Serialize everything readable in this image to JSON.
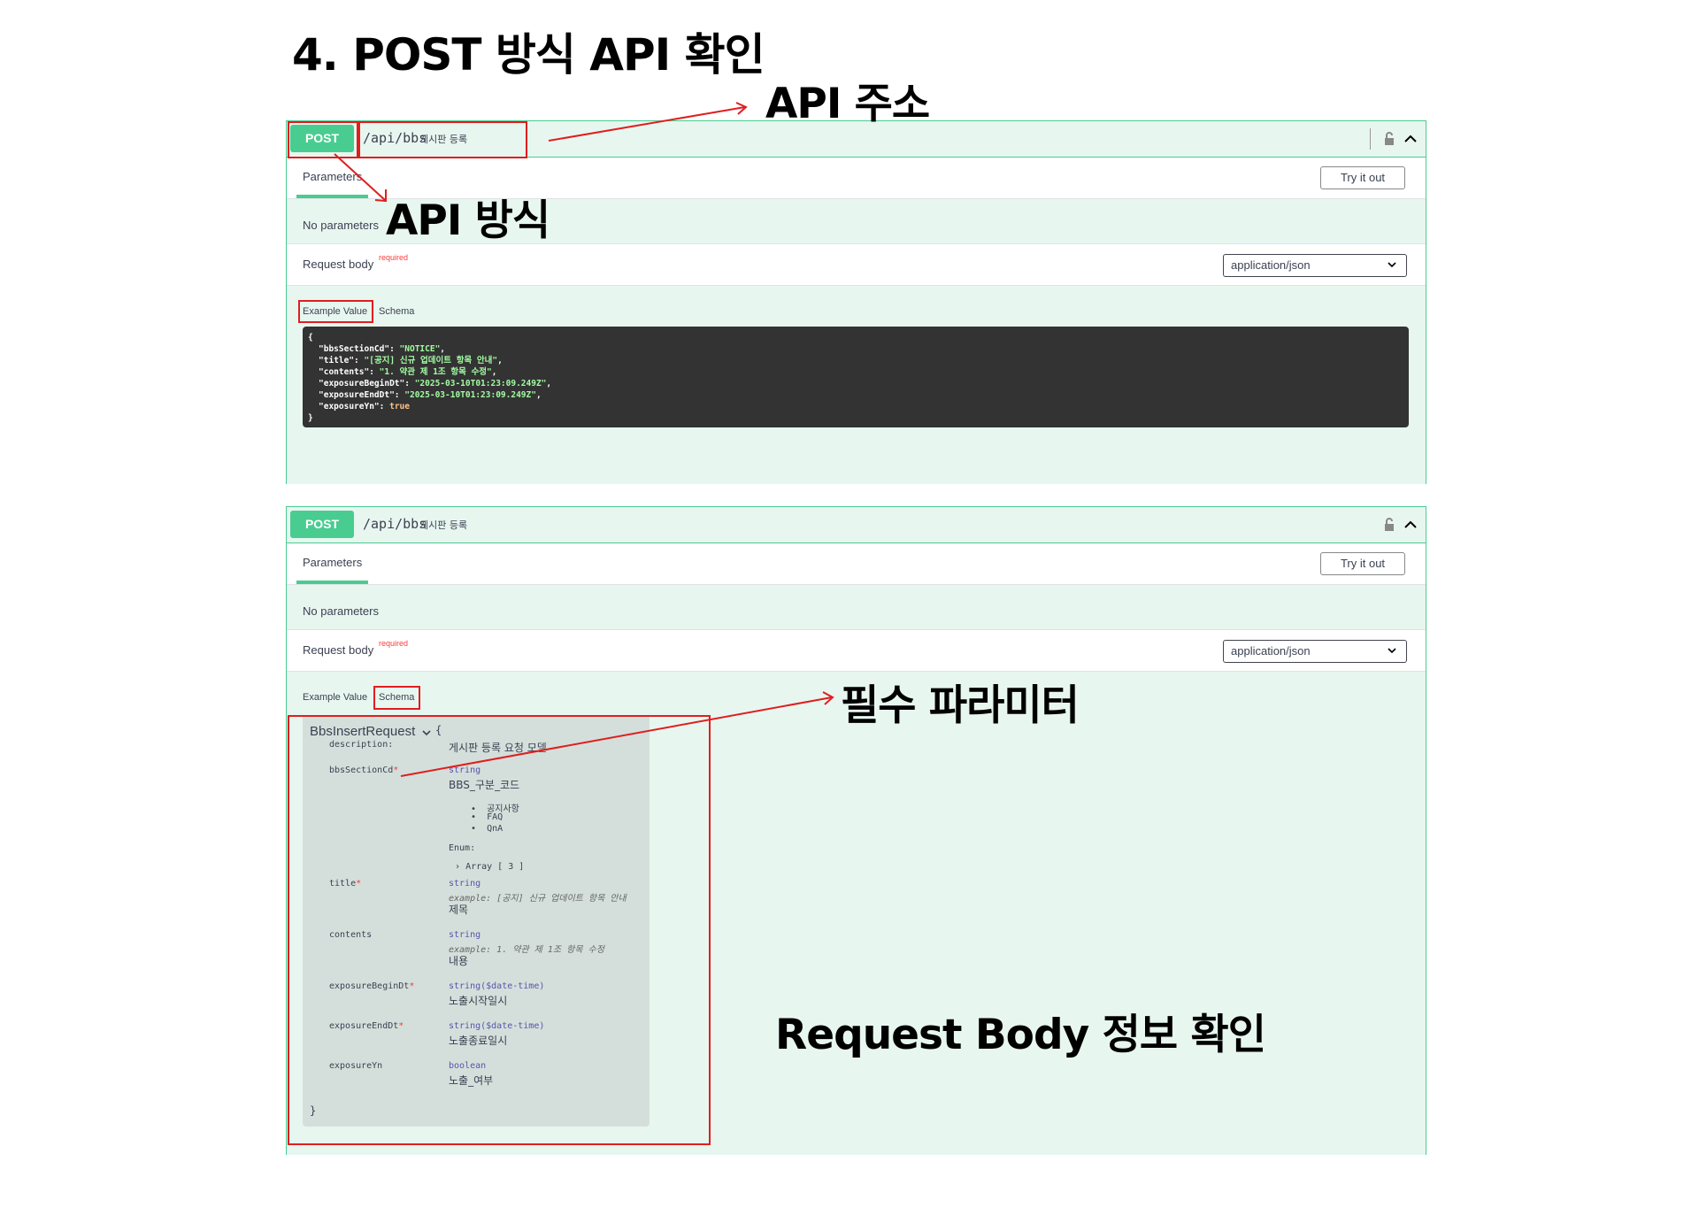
{
  "page_title": "4. POST 방식 API 확인",
  "callouts": {
    "api_address": "API 주소",
    "api_method": "API 방식",
    "required_params": "필수 파라미터",
    "request_body_info": "Request Body 정보 확인"
  },
  "colors": {
    "post_green": "#49cc90",
    "annotation_red": "#e01e1e",
    "op_bg": "#e8f6f0"
  },
  "operation": {
    "method": "POST",
    "path": "/api/bbs",
    "summary": "게시판 등록",
    "tab_parameters": "Parameters",
    "try_button": "Try it out",
    "no_parameters": "No parameters",
    "request_body_label": "Request body",
    "required_label": "required",
    "content_type": "application/json",
    "example_tab": "Example Value",
    "schema_tab": "Schema",
    "icons": [
      "lock-icon",
      "chevron-up-icon",
      "chevron-down-icon"
    ]
  },
  "example_json": {
    "open": "{",
    "close": "}",
    "lines": [
      {
        "key": "\"bbsSectionCd\"",
        "value": "\"NOTICE\"",
        "comma": ","
      },
      {
        "key": "\"title\"",
        "value": "\"[공지] 신규 업데이트 항목 안내\"",
        "comma": ","
      },
      {
        "key": "\"contents\"",
        "value": "\"1. 약관 제 1조 항목 수정\"",
        "comma": ","
      },
      {
        "key": "\"exposureBeginDt\"",
        "value": "\"2025-03-10T01:23:09.249Z\"",
        "comma": ","
      },
      {
        "key": "\"exposureEndDt\"",
        "value": "\"2025-03-10T01:23:09.249Z\"",
        "comma": ","
      },
      {
        "key": "\"exposureYn\"",
        "value": "true",
        "comma": ""
      }
    ]
  },
  "schema": {
    "model_name": "BbsInsertRequest",
    "open": "{",
    "close": "}",
    "description_label": "description:",
    "description": "게시판 등록 요청 모델",
    "props": {
      "bbsSectionCd": {
        "name": "bbsSectionCd",
        "required": "*",
        "type": "string",
        "desc": "BBS_구분_코드",
        "enum_items": [
          "공지사항",
          "FAQ",
          "QnA"
        ],
        "enum_label": "Enum:",
        "enum_array": "Array [ 3 ]"
      },
      "title": {
        "name": "title",
        "required": "*",
        "type": "string",
        "example": "example: [공지] 신규 업데이트 항목 안내",
        "desc": "제목"
      },
      "contents": {
        "name": "contents",
        "type": "string",
        "example": "example: 1. 약관 제 1조 항목 수정",
        "desc": "내용"
      },
      "exposureBeginDt": {
        "name": "exposureBeginDt",
        "required": "*",
        "type": "string($date-time)",
        "desc": "노출시작일시"
      },
      "exposureEndDt": {
        "name": "exposureEndDt",
        "required": "*",
        "type": "string($date-time)",
        "desc": "노출종료일시"
      },
      "exposureYn": {
        "name": "exposureYn",
        "type": "boolean",
        "desc": "노출_여부"
      }
    }
  }
}
